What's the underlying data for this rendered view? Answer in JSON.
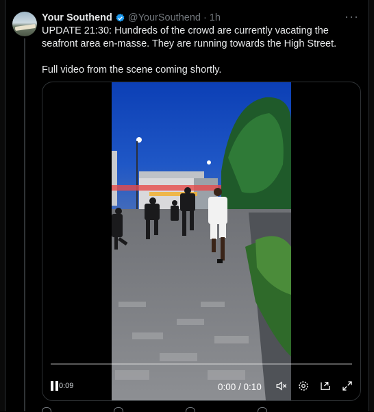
{
  "tweet": {
    "author_name": "Your Southend",
    "author_handle": "@YourSouthend",
    "separator": "·",
    "timestamp": "1h",
    "more_icon": "more-horizontal-icon",
    "verified_icon": "verified-badge-icon",
    "text_line1": "UPDATE 21:30: Hundreds of the crowd are currently vacating the seafront area en-masse. They are running towards the High Street.",
    "text_line2": "Full video from the scene coming shortly."
  },
  "video": {
    "time_display": "0:00 / 0:10",
    "badge": "0:09",
    "progress": 0,
    "icons": [
      "pause-icon",
      "mute-icon",
      "settings-icon",
      "pip-icon",
      "fullscreen-icon"
    ]
  },
  "colors": {
    "background": "#000000",
    "text_primary": "#e7e9ea",
    "text_secondary": "#71767b",
    "border": "#2f3336",
    "verified": "#1d9bf0"
  }
}
